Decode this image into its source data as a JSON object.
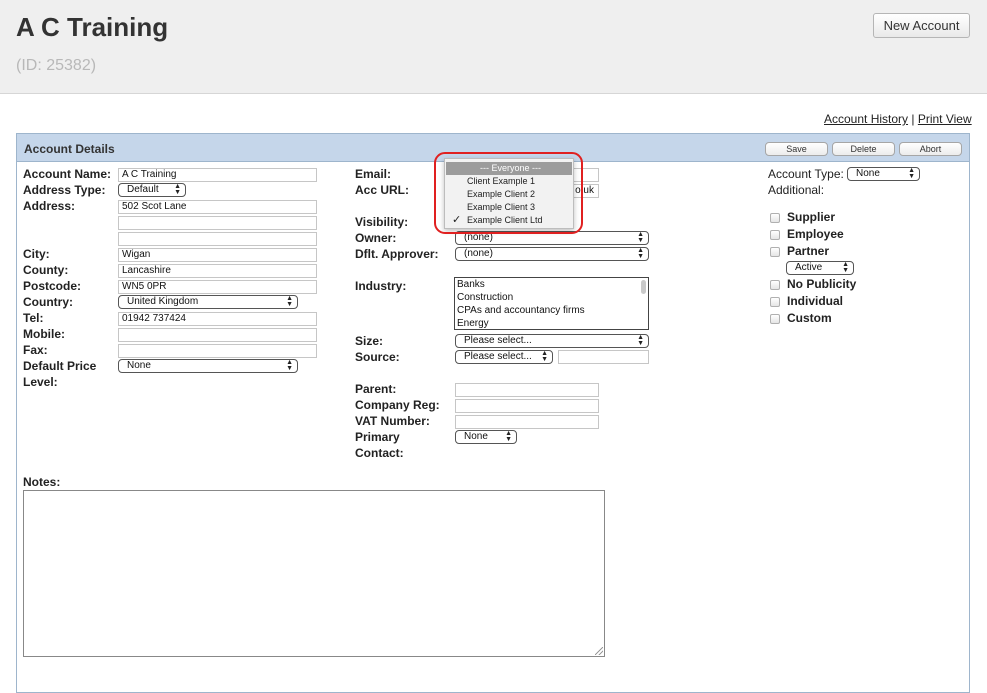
{
  "page": {
    "title": "A C Training",
    "id_label": "(ID: 25382)",
    "new_account_label": "New Account",
    "account_history_label": "Account History",
    "separator": "|",
    "print_view_label": "Print View"
  },
  "panel": {
    "title": "Account Details",
    "save_label": "Save",
    "delete_label": "Delete",
    "abort_label": "Abort"
  },
  "left": {
    "account_name_label": "Account Name:",
    "account_name_value": "A C Training",
    "address_type_label": "Address Type:",
    "address_type_value": "Default",
    "address_label": "Address:",
    "address_line1": "502 Scot Lane",
    "address_line2": "",
    "address_line3": "",
    "city_label": "City:",
    "city_value": "Wigan",
    "county_label": "County:",
    "county_value": "Lancashire",
    "postcode_label": "Postcode:",
    "postcode_value": "WN5 0PR",
    "country_label": "Country:",
    "country_value": "United Kingdom",
    "tel_label": "Tel:",
    "tel_value": "01942 737424",
    "mobile_label": "Mobile:",
    "mobile_value": "",
    "fax_label": "Fax:",
    "fax_value": "",
    "default_price_label_1": "Default Price",
    "default_price_label_2": "Level:",
    "default_price_value": "None"
  },
  "middle": {
    "email_label": "Email:",
    "acc_url_label": "Acc URL:",
    "acc_url_visible_tail": "o.uk",
    "visibility_label": "Visibility:",
    "owner_label": "Owner:",
    "owner_value": "(none)",
    "approver_label": "Dflt. Approver:",
    "approver_value": "(none)",
    "industry_label": "Industry:",
    "industry_options": [
      "Banks",
      "Construction",
      "CPAs and accountancy firms",
      "Energy"
    ],
    "size_label": "Size:",
    "size_value": "Please select...",
    "source_label": "Source:",
    "source_value": "Please select...",
    "parent_label": "Parent:",
    "company_reg_label": "Company Reg:",
    "vat_label": "VAT Number:",
    "primary_contact_label_1": "Primary",
    "primary_contact_label_2": "Contact:",
    "primary_contact_value": "None"
  },
  "visibility_dropdown": {
    "options": [
      "--- Everyone ---",
      "Client Example 1",
      "Example Client 2",
      "Example Client 3",
      "Example Client Ltd"
    ],
    "highlighted_index": 0,
    "checked_index": 4,
    "check_glyph": "✓"
  },
  "right": {
    "account_type_label": "Account Type:",
    "account_type_value": "None",
    "additional_label": "Additional:",
    "supplier_label": "Supplier",
    "employee_label": "Employee",
    "partner_label": "Partner",
    "partner_status_value": "Active",
    "no_publicity_label": "No Publicity",
    "individual_label": "Individual",
    "custom_label": "Custom"
  },
  "notes": {
    "label": "Notes:",
    "value": ""
  }
}
